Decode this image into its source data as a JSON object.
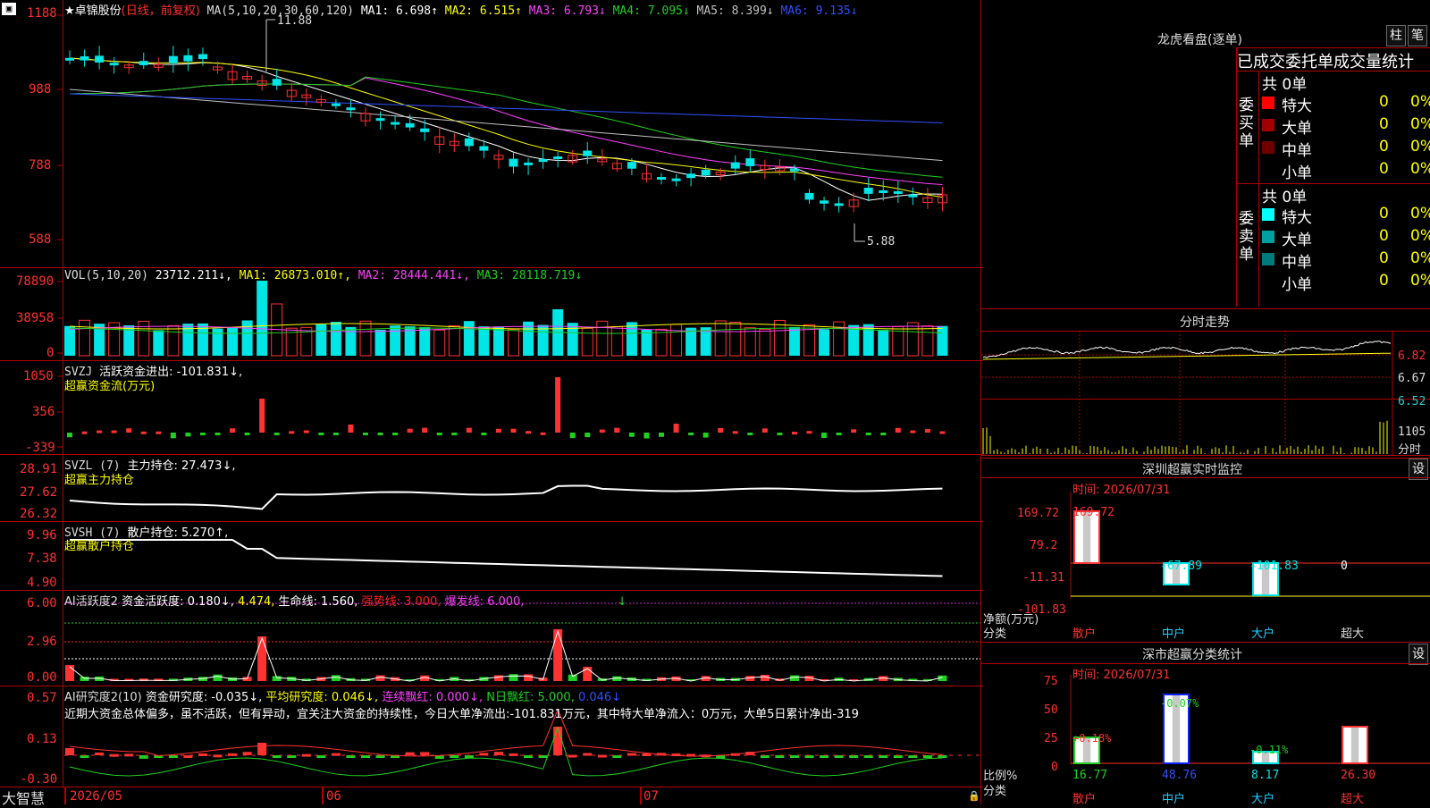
{
  "main_header": {
    "axis_top": "1188",
    "stock_name": "★卓锦股份",
    "period": "(日线，前复权)",
    "ma_params": "MA(5,10,20,30,60,120)",
    "ma1": "MA1: 6.698↑",
    "ma2": "MA2: 6.515↑",
    "ma3": "MA3: 6.793↓",
    "ma4": "MA4: 7.095↓",
    "ma5": "MA5: 8.399↓",
    "ma6": "MA6: 9.135↓",
    "high_label": "11.88",
    "low_label": "5.88"
  },
  "price_axis": [
    "988",
    "788",
    "588"
  ],
  "vol_header": {
    "name": "VOL(5,10,20)",
    "value": "23712.211↓,",
    "ma1": "MA1: 26873.010↑,",
    "ma2": "MA2: 28444.441↓,",
    "ma3": "MA3: 28118.719↓"
  },
  "vol_axis": [
    "78890",
    "38958",
    "0"
  ],
  "svzj_header": {
    "name": "SVZJ",
    "label": "活跃资金进出: -101.831↓,",
    "sub": "超赢资金流(万元)"
  },
  "svzj_axis": [
    "1050",
    "356",
    "-339"
  ],
  "svzl_header": {
    "name": "SVZL (7)",
    "label": "主力持仓: 27.473↓,",
    "sub": "超赢主力持仓"
  },
  "svzl_axis": [
    "28.91",
    "27.62",
    "26.32"
  ],
  "svsh_header": {
    "name": "SVSH (7)",
    "label": "散户持仓: 5.270↑,",
    "sub": "超赢散户持仓"
  },
  "svsh_axis": [
    "9.96",
    "7.38",
    "4.90"
  ],
  "ai1_header": {
    "name": "AI活跃度2",
    "label": "资金活跃度: 0.180↓,",
    "v2": "4.474,",
    "life": "生命线: 1.560,",
    "strong": "强势线: 3.000,",
    "burst": "爆发线: 6.000,",
    "arrow": "↓"
  },
  "ai1_axis": [
    "6.00",
    "2.96",
    "0.00"
  ],
  "ai2_header": {
    "name": "AI研究度2(10)",
    "label": "资金研究度: -0.035↓,",
    "avg": "平均研究度: 0.046↓,",
    "cont": "连续飘红: 0.000↓,",
    "nday": "N日飘红: 5.000,",
    "last": "0.046↓"
  },
  "ai2_comment": "近期大资金总体偏多，虽不活跃，但有异动，宜关注大资金的持续性，今日大单净流出:-101.831万元，其中特大单净流入：0万元，大单5日累计净出-319",
  "ai2_axis": [
    "0.57",
    "0.13",
    "-0.30"
  ],
  "bottom_bar": {
    "brand": "大智慧",
    "date1": "2026/05",
    "date2": "06",
    "date3": "07"
  },
  "right": {
    "dragon_title": "龙虎看盘(逐单)",
    "btn_zhu": "柱",
    "btn_bi": "笔",
    "stats_title": "已成交委托单成交量统计",
    "buy_label": "委买单",
    "sell_label": "委卖单",
    "buy_total": "共 0单",
    "sell_total": "共 0单",
    "buy_rows": [
      {
        "name": "特大",
        "count": "0",
        "pct": "0%",
        "color": "#ff0000"
      },
      {
        "name": "大单",
        "count": "0",
        "pct": "0%",
        "color": "#a00000"
      },
      {
        "name": "中单",
        "count": "0",
        "pct": "0%",
        "color": "#700000"
      },
      {
        "name": "小单",
        "count": "0",
        "pct": "0%",
        "color": "#000000"
      }
    ],
    "sell_rows": [
      {
        "name": "特大",
        "count": "0",
        "pct": "0%",
        "color": "#00ffff"
      },
      {
        "name": "大单",
        "count": "0",
        "pct": "0%",
        "color": "#00a0a0"
      },
      {
        "name": "中单",
        "count": "0",
        "pct": "0%",
        "color": "#007a7a"
      },
      {
        "name": "小单",
        "count": "0",
        "pct": "0%",
        "color": "#000000"
      }
    ],
    "intraday_title": "分时走势",
    "intraday_axis": [
      "6.82",
      "6.67",
      "6.52"
    ],
    "intraday_vol": "1105",
    "intraday_vol_label": "分时",
    "monitor_title": "深圳超赢实时监控",
    "monitor_btn": "设",
    "monitor_time": "时间: 2026/07/31",
    "monitor_axis": [
      "169.72",
      "79.2",
      "-11.31",
      "-101.83"
    ],
    "monitor_ylabel": "净额(万元)",
    "monitor_xlabel": "分类",
    "monitor_values": [
      "169.72",
      "-67.89",
      "-101.83",
      "0"
    ],
    "monitor_cats": [
      "散户",
      "中户",
      "大户",
      "超大"
    ],
    "class_title": "深市超赢分类统计",
    "class_btn": "设",
    "class_time": "时间: 2026/07/31",
    "class_axis": [
      "75",
      "50",
      "25",
      "0"
    ],
    "class_ylabel": "比例%",
    "class_xlabel": "分类",
    "class_changes": [
      "+0.18%",
      "-0.07%",
      "-0.11%"
    ],
    "class_values": [
      "16.77",
      "48.76",
      "8.17",
      "26.30"
    ],
    "class_cats": [
      "散户",
      "中户",
      "大户",
      "超大"
    ]
  },
  "colors": {
    "up": "#ff3232",
    "down": "#00e5e5",
    "grid": "#b00000"
  }
}
